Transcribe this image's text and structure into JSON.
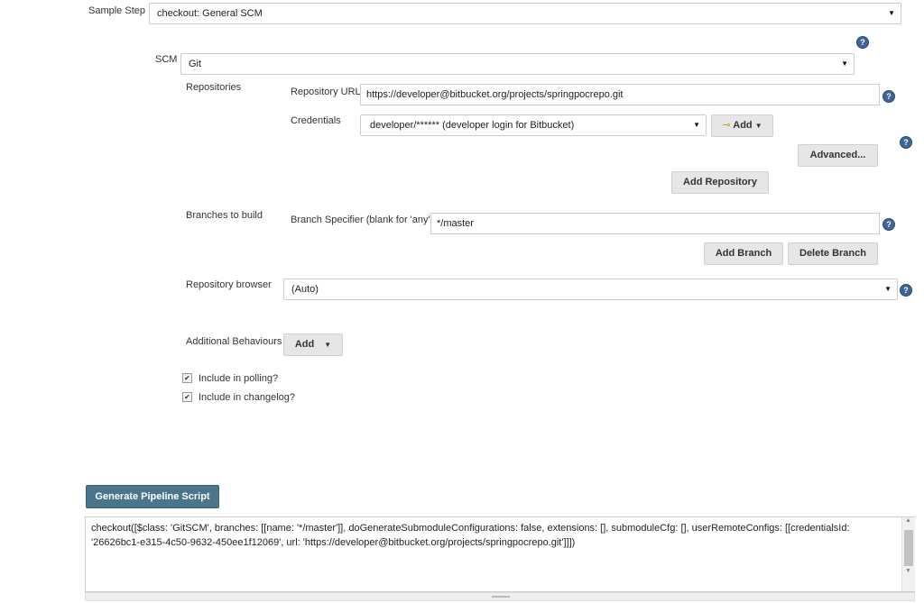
{
  "sample_step": {
    "label": "Sample Step",
    "value": "checkout: General SCM"
  },
  "scm": {
    "label": "SCM",
    "value": "Git"
  },
  "repositories": {
    "label": "Repositories",
    "url_label": "Repository URL",
    "url_value": "https://developer@bitbucket.org/projects/springpocrepo.git",
    "credentials_label": "Credentials",
    "credentials_value": "developer/****** (developer login for Bitbucket)",
    "add_label": "Add",
    "advanced_label": "Advanced...",
    "add_repository_label": "Add Repository"
  },
  "branches": {
    "label": "Branches to build",
    "specifier_label": "Branch Specifier (blank for 'any')",
    "specifier_value": "*/master",
    "add_branch_label": "Add Branch",
    "delete_branch_label": "Delete Branch"
  },
  "repo_browser": {
    "label": "Repository browser",
    "value": "(Auto)"
  },
  "behaviours": {
    "label": "Additional Behaviours",
    "add_label": "Add"
  },
  "polling": {
    "label": "Include in polling?",
    "checked": true
  },
  "changelog": {
    "label": "Include in changelog?",
    "checked": true
  },
  "generate": {
    "label": "Generate Pipeline Script"
  },
  "script_output": "checkout([$class: 'GitSCM', branches: [[name: '*/master']], doGenerateSubmoduleConfigurations: false, extensions: [], submoduleCfg: [], userRemoteConfigs: [[credentialsId: '26626bc1-e315-4c50-9632-450ee1f12069', url: 'https://developer@bitbucket.org/projects/springpocrepo.git']]])",
  "colors": {
    "help": "#3e6595",
    "primary_button": "#4b758b"
  },
  "icons": {
    "help": "question-mark-circle-icon",
    "key": "key-icon",
    "caret": "caret-down-icon"
  }
}
